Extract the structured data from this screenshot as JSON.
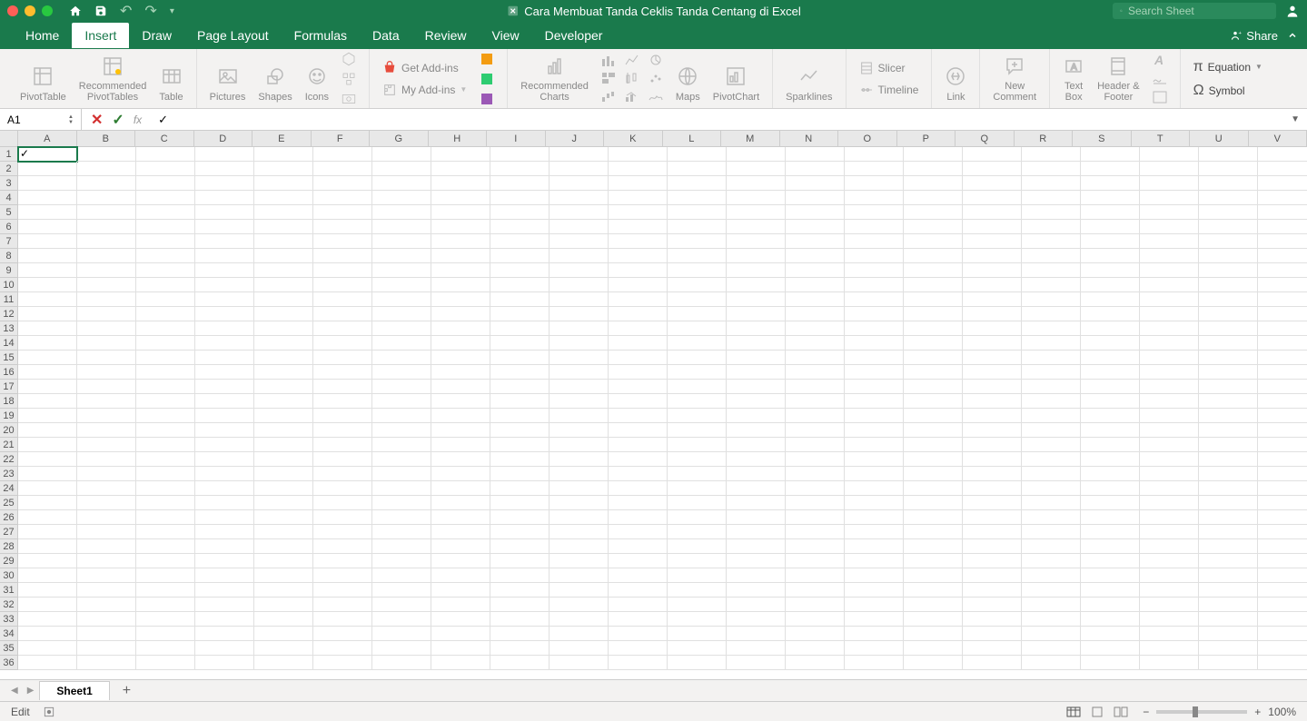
{
  "title": "Cara Membuat Tanda Ceklis Tanda Centang di Excel",
  "search_placeholder": "Search Sheet",
  "menu": {
    "home": "Home",
    "insert": "Insert",
    "draw": "Draw",
    "page_layout": "Page Layout",
    "formulas": "Formulas",
    "data": "Data",
    "review": "Review",
    "view": "View",
    "developer": "Developer"
  },
  "share": "Share",
  "ribbon": {
    "pivottable": "PivotTable",
    "rec_pivot": "Recommended\nPivotTables",
    "table": "Table",
    "pictures": "Pictures",
    "shapes": "Shapes",
    "icons": "Icons",
    "getaddins": "Get Add-ins",
    "myaddins": "My Add-ins",
    "rec_charts": "Recommended\nCharts",
    "maps": "Maps",
    "pivotchart": "PivotChart",
    "sparklines": "Sparklines",
    "slicer": "Slicer",
    "timeline": "Timeline",
    "link": "Link",
    "comment": "New\nComment",
    "textbox": "Text\nBox",
    "headerfooter": "Header &\nFooter",
    "equation": "Equation",
    "symbol": "Symbol"
  },
  "namebox": "A1",
  "formula_value": "✓",
  "cell_a1": "✓",
  "columns": [
    "A",
    "B",
    "C",
    "D",
    "E",
    "F",
    "G",
    "H",
    "I",
    "J",
    "K",
    "L",
    "M",
    "N",
    "O",
    "P",
    "Q",
    "R",
    "S",
    "T",
    "U",
    "V"
  ],
  "rows": [
    1,
    2,
    3,
    4,
    5,
    6,
    7,
    8,
    9,
    10,
    11,
    12,
    13,
    14,
    15,
    16,
    17,
    18,
    19,
    20,
    21,
    22,
    23,
    24,
    25,
    26,
    27,
    28,
    29,
    30,
    31,
    32,
    33,
    34,
    35,
    36
  ],
  "sheet1": "Sheet1",
  "status_edit": "Edit",
  "zoom": "100%"
}
